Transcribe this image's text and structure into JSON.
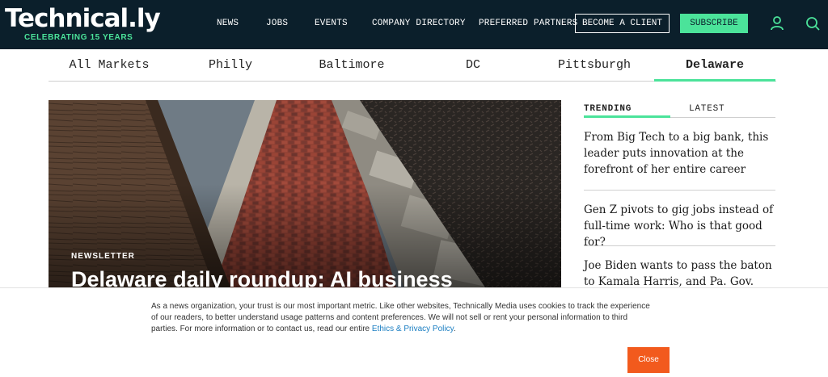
{
  "header": {
    "logo_text": "Technical.ly",
    "logo_tagline": "CELEBRATING 15 YEARS",
    "nav": [
      {
        "label": "NEWS"
      },
      {
        "label": "JOBS"
      },
      {
        "label": "EVENTS"
      },
      {
        "label": "COMPANY DIRECTORY"
      },
      {
        "label": "PREFERRED PARTNERS"
      }
    ],
    "become_client_label": "BECOME A CLIENT",
    "subscribe_label": "SUBSCRIBE",
    "icons": [
      "user-icon",
      "search-icon"
    ],
    "accent_color": "#4be39a",
    "background_color": "#0b1f2b"
  },
  "markets": {
    "items": [
      {
        "label": "All Markets"
      },
      {
        "label": "Philly"
      },
      {
        "label": "Baltimore"
      },
      {
        "label": "DC"
      },
      {
        "label": "Pittsburgh"
      },
      {
        "label": "Delaware"
      }
    ],
    "active": "Delaware"
  },
  "hero": {
    "kicker": "NEWSLETTER",
    "title": "Delaware daily roundup: AI business"
  },
  "sidebar": {
    "tabs": [
      {
        "label": "TRENDING"
      },
      {
        "label": "LATEST"
      }
    ],
    "active_tab": "TRENDING",
    "stories": [
      {
        "title": "From Big Tech to a big bank, this leader puts innovation at the forefront of her entire career"
      },
      {
        "title": "Gen Z pivots to gig jobs instead of full-time work: Who is that good for?"
      },
      {
        "title": "Joe Biden wants to pass the baton to Kamala Harris, and Pa. Gov. Josh"
      }
    ]
  },
  "cookie_banner": {
    "text": "As a news organization, your trust is our most important metric. Like other websites, Technically Media uses cookies to track the experience of our readers, to better understand usage patterns and content preferences. We will not sell or rent your personal information to third parties. For more information or to contact us, read our entire ",
    "link_text": "Ethics & Privacy Policy",
    "text_end": ".",
    "close_label": "Close",
    "close_color": "#f25a1d"
  }
}
